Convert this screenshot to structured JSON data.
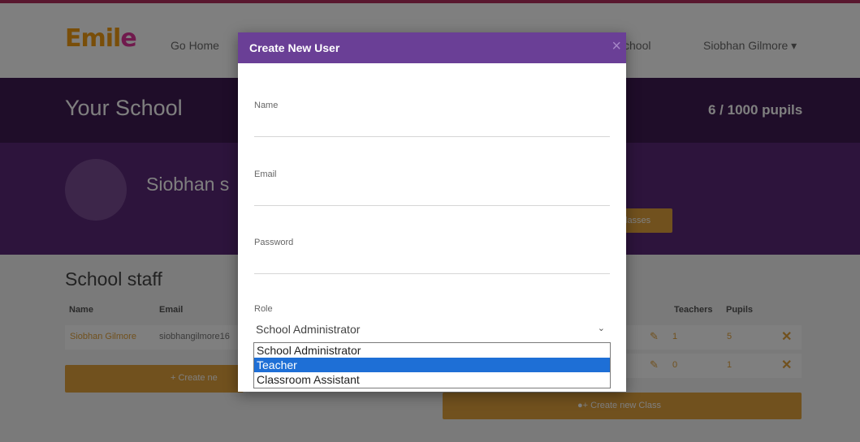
{
  "nav": {
    "logo": "Emile",
    "home": "Go Home",
    "school": "chool",
    "user": "Siobhan Gilmore ▾"
  },
  "school": {
    "title": "Your School",
    "pupils": "6 / 1000 pupils"
  },
  "profile": {
    "name": "Siobhan s",
    "classes_button": "lasses"
  },
  "staff": {
    "title": "School staff",
    "col_name": "Name",
    "col_email": "Email",
    "rows": [
      {
        "name": "Siobhan Gilmore",
        "email": "siobhangilmore16"
      }
    ],
    "create_button": "Create ne"
  },
  "classes": {
    "col_teachers": "Teachers",
    "col_pupils": "Pupils",
    "rows": [
      {
        "teachers": "1",
        "pupils": "5"
      },
      {
        "teachers": "0",
        "pupils": "1"
      }
    ],
    "create_button": "Create new Class"
  },
  "modal": {
    "title": "Create New User",
    "close": "×",
    "name_label": "Name",
    "email_label": "Email",
    "password_label": "Password",
    "role_label": "Role",
    "role_value": "School Administrator",
    "role_options": [
      "School Administrator",
      "Teacher",
      "Classroom Assistant"
    ],
    "highlighted_option": "Teacher"
  },
  "colors": {
    "header_purple": "#6a3f96",
    "accent_orange": "#e2a23c",
    "school_bar": "#3f1a52",
    "profile_band": "#5a2978",
    "selected_option": "#1e6fd6"
  }
}
